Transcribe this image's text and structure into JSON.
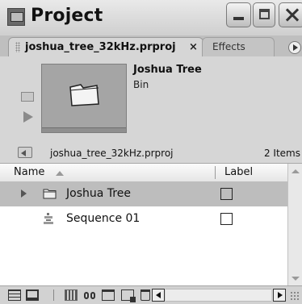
{
  "window": {
    "title": "Project",
    "controls": [
      "minimize-icon",
      "maximize-icon",
      "close-icon"
    ]
  },
  "tabs": [
    {
      "label": "joshua_tree_32kHz.prproj",
      "close": "×",
      "active": true
    },
    {
      "label": "Effects",
      "active": false
    }
  ],
  "preview": {
    "item_name": "Joshua Tree",
    "item_type": "Bin",
    "thumbnail_icon": "folder-icon"
  },
  "pathbar": {
    "project_file": "joshua_tree_32kHz.prproj",
    "item_count": "2 Items"
  },
  "list": {
    "columns": {
      "name": "Name",
      "label": "Label"
    },
    "rows": [
      {
        "name": "Joshua Tree",
        "icon": "folder-icon",
        "selected": true,
        "expandable": true
      },
      {
        "name": "Sequence 01",
        "icon": "sequence-icon",
        "selected": false,
        "expandable": false
      }
    ]
  },
  "toolbar": {
    "icons": [
      "list-view-icon",
      "icon-view-icon",
      "automate-to-sequence-icon",
      "find-icon",
      "new-bin-icon",
      "new-item-icon",
      "clear-icon",
      "scroll-left-icon",
      "scroll-right-icon"
    ]
  },
  "colors": {
    "panel_bg": "#d6d6d6",
    "selected_row": "#bdbdbd",
    "list_bg": "#ffffff"
  }
}
